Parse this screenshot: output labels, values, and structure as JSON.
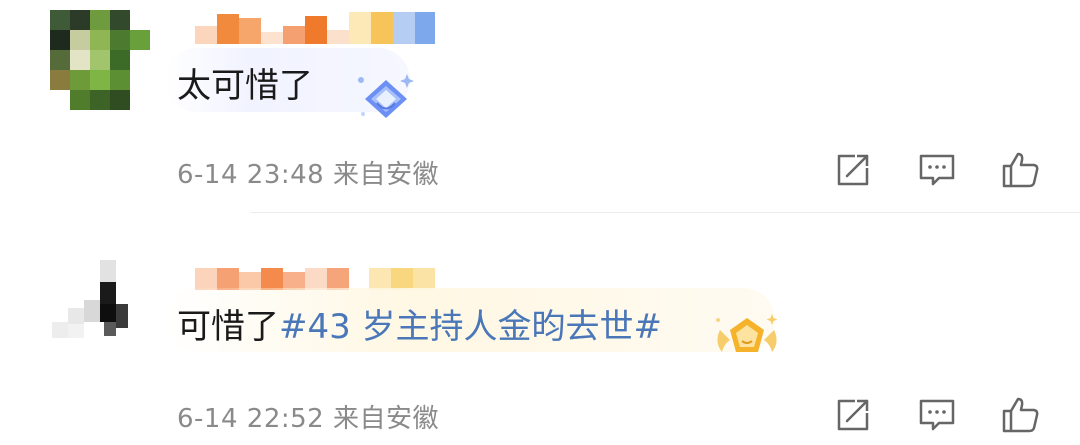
{
  "comments": [
    {
      "text": "太可惜了",
      "hashtag": "",
      "timestamp": "6-14 23:48",
      "location": "来自安徽",
      "badge_icon": "diamond-badge-icon",
      "badge_color": "#6b8ff5"
    },
    {
      "text": "可惜了",
      "hashtag": "#43 岁主持人金昀去世#",
      "timestamp": "6-14 22:52",
      "location": "来自安徽",
      "badge_icon": "gold-pentagon-badge-icon",
      "badge_color": "#f5b32b"
    }
  ],
  "actions": {
    "share_icon": "share-icon",
    "reply_icon": "comment-icon",
    "like_icon": "thumbs-up-icon",
    "icon_color": "#666666"
  },
  "colors": {
    "hashtag": "#4a77b8",
    "meta": "#8a8a8a",
    "text": "#1a1a1a"
  }
}
